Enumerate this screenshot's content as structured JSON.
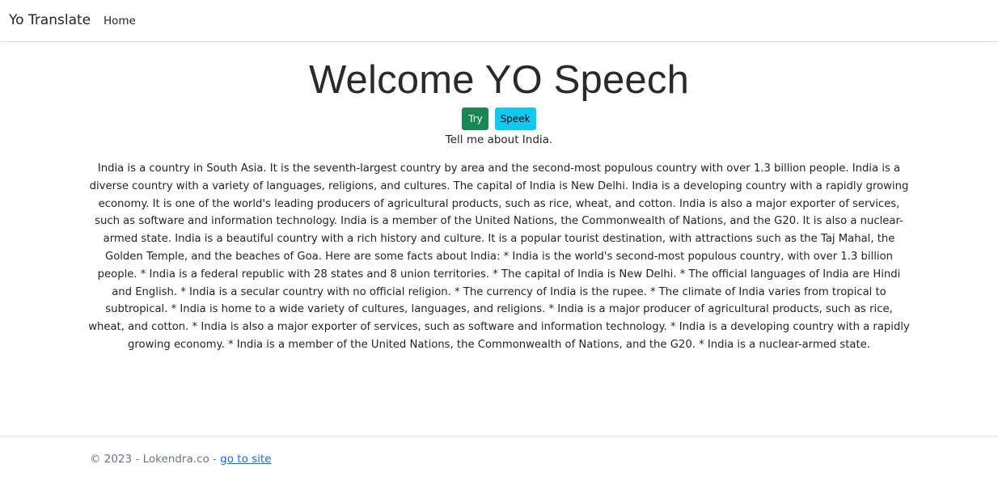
{
  "navbar": {
    "brand": "Yo Translate",
    "home": "Home"
  },
  "main": {
    "title": "Welcome YO Speech",
    "try_label": "Try",
    "speek_label": "Speek",
    "prompt": "Tell me about India.",
    "answer": "India is a country in South Asia. It is the seventh-largest country by area and the second-most populous country with over 1.3 billion people. India is a diverse country with a variety of languages, religions, and cultures. The capital of India is New Delhi. India is a developing country with a rapidly growing economy. It is one of the world's leading producers of agricultural products, such as rice, wheat, and cotton. India is also a major exporter of services, such as software and information technology. India is a member of the United Nations, the Commonwealth of Nations, and the G20. It is also a nuclear-armed state. India is a beautiful country with a rich history and culture. It is a popular tourist destination, with attractions such as the Taj Mahal, the Golden Temple, and the beaches of Goa. Here are some facts about India: * India is the world's second-most populous country, with over 1.3 billion people. * India is a federal republic with 28 states and 8 union territories. * The capital of India is New Delhi. * The official languages of India are Hindi and English. * India is a secular country with no official religion. * The currency of India is the rupee. * The climate of India varies from tropical to subtropical. * India is home to a wide variety of cultures, languages, and religions. * India is a major producer of agricultural products, such as rice, wheat, and cotton. * India is also a major exporter of services, such as software and information technology. * India is a developing country with a rapidly growing economy. * India is a member of the United Nations, the Commonwealth of Nations, and the G20. * India is a nuclear-armed state."
  },
  "footer": {
    "copyright": "© 2023 - Lokendra.co - ",
    "link_label": "go to site"
  },
  "colors": {
    "try_button": "#198754",
    "speek_button": "#0dcaf0",
    "link": "#0d6efd",
    "footer_text": "#6c757d"
  }
}
